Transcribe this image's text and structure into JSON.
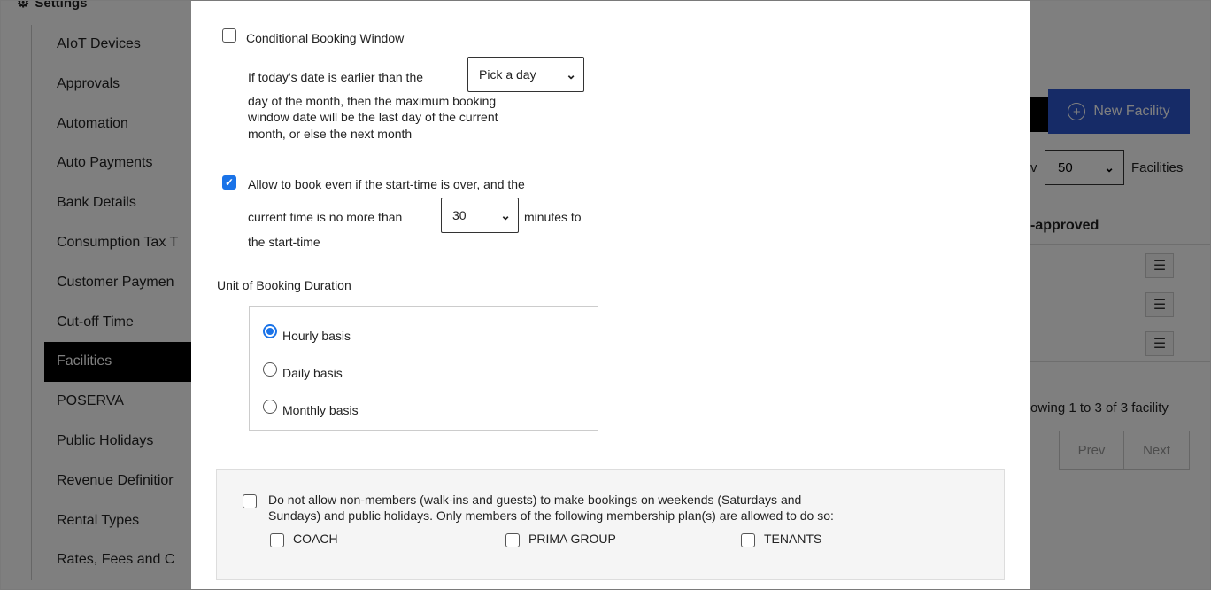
{
  "sidebar": {
    "heading": "Settings",
    "items": [
      {
        "label": "AIoT Devices"
      },
      {
        "label": "Approvals"
      },
      {
        "label": "Automation"
      },
      {
        "label": "Auto Payments"
      },
      {
        "label": "Bank Details"
      },
      {
        "label": "Consumption Tax T"
      },
      {
        "label": "Customer Paymen"
      },
      {
        "label": "Cut-off Time"
      },
      {
        "label": "Facilities"
      },
      {
        "label": "POSERVA"
      },
      {
        "label": "Public Holidays"
      },
      {
        "label": "Revenue Definitior"
      },
      {
        "label": "Rental Types"
      },
      {
        "label": "Rates, Fees and C"
      }
    ]
  },
  "background": {
    "new_facility": "New Facility",
    "show_suffix": "v",
    "page_size": "50",
    "facilities_label": "Facilities",
    "approved_header": "-approved",
    "row_menu_icon": "☰",
    "showing": "owing 1 to 3 of 3 facility",
    "prev": "Prev",
    "next": "Next"
  },
  "modal": {
    "conditional_window": {
      "label": "Conditional Booking Window",
      "checked": false,
      "line1": "If today's date is earlier than the",
      "pick_day": "Pick a day",
      "line2": "day of the month, then the maximum booking",
      "line3": "window date will be the last day of the current",
      "line4": "month, or else the next month"
    },
    "allow_late": {
      "checked": true,
      "line1": "Allow to book even if the start-time is over, and the",
      "line2_pre": "current time is no more than",
      "minutes_value": "30",
      "line2_post": "minutes to",
      "line3": "the start-time"
    },
    "duration": {
      "label": "Unit of Booking Duration",
      "options": [
        {
          "label": "Hourly basis",
          "selected": true
        },
        {
          "label": "Daily basis",
          "selected": false
        },
        {
          "label": "Monthly basis",
          "selected": false
        }
      ]
    },
    "weekend": {
      "checked": false,
      "line1": "Do not allow non-members (walk-ins and guests) to make bookings on weekends (Saturdays and",
      "line2": "Sundays) and public holidays. Only members of the following membership plan(s) are allowed to do so:",
      "plans": [
        {
          "label": "COACH"
        },
        {
          "label": "PRIMA GROUP"
        },
        {
          "label": "TENANTS"
        }
      ]
    }
  },
  "colors": {
    "accent": "#1a73e8",
    "button_blue": "#2c57cf"
  }
}
